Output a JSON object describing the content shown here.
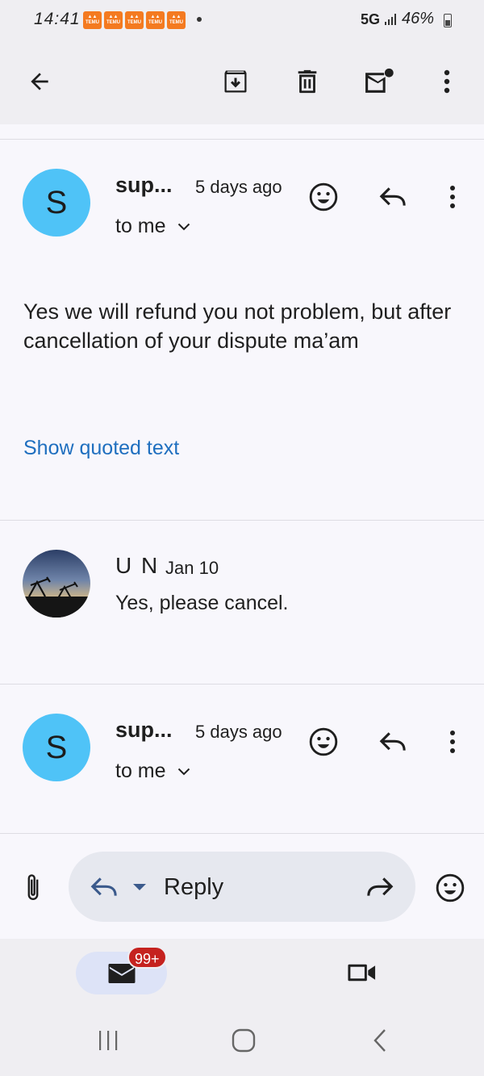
{
  "status_bar": {
    "time": "14:41",
    "notification_icons": [
      "TEMU",
      "TEMU",
      "TEMU",
      "TEMU",
      "TEMU"
    ],
    "network": "5G",
    "battery": "46%"
  },
  "toolbar": {
    "icons": [
      "back-arrow-icon",
      "archive-icon",
      "delete-icon",
      "mark-unread-icon",
      "more-vert-icon"
    ]
  },
  "messages": [
    {
      "avatar_letter": "S",
      "sender": "sup...",
      "time": "5 days ago",
      "recipient": "to me",
      "body": "Yes we will refund you not problem, but after cancellation of your dispute ma’am",
      "show_quoted": "Show quoted text"
    },
    {
      "sender": "U N",
      "time": "Jan 10",
      "snippet": "Yes, please cancel."
    },
    {
      "avatar_letter": "S",
      "sender": "sup...",
      "time": "5 days ago",
      "recipient": "to me"
    }
  ],
  "reply_bar": {
    "reply_label": "Reply"
  },
  "bottom_nav": {
    "mail_badge": "99+"
  },
  "colors": {
    "avatar": "#4fc3f7",
    "link": "#1f6fbf",
    "badge": "#c5221f",
    "accent_pill": "#dde3f7"
  }
}
